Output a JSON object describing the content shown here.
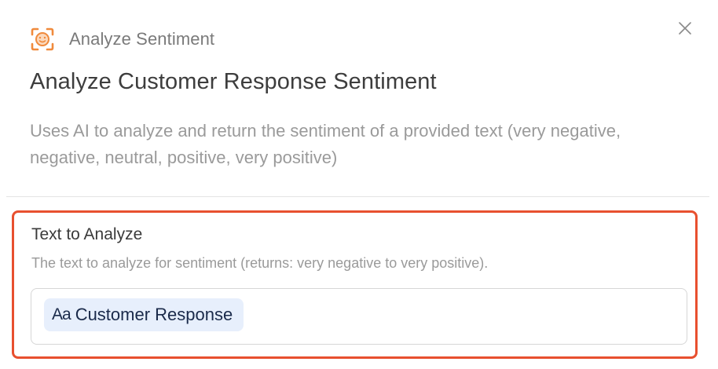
{
  "header": {
    "icon": "smiley-scan-icon",
    "label": "Analyze Sentiment",
    "close_icon": "close-icon"
  },
  "title": "Analyze Customer Response Sentiment",
  "description": "Uses AI to analyze and return the sentiment of a provided text (very negative, negative, neutral, positive, very positive)",
  "field": {
    "label": "Text to Analyze",
    "help": "The text to analyze for sentiment (returns: very negative to very positive).",
    "token": {
      "icon_text": "Aa",
      "label": "Customer Response"
    }
  },
  "colors": {
    "accent_orange": "#e8502f",
    "icon_orange": "#f08a3c",
    "token_bg": "#e7effc",
    "token_text": "#1a2a4a"
  }
}
